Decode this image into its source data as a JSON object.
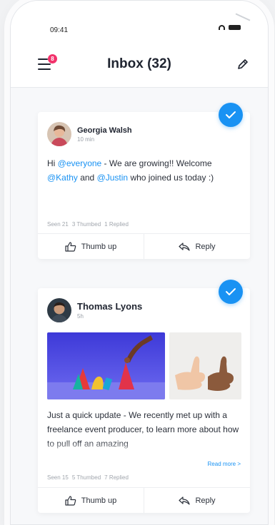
{
  "status": {
    "time": "09:41"
  },
  "nav": {
    "title": "Inbox (32)",
    "menu_badge": "8"
  },
  "posts": [
    {
      "author": "Georgia Walsh",
      "time": "10 min",
      "text_parts": [
        "Hi ",
        "@everyone",
        " - We are growing!! Welcome ",
        "@Kathy",
        " and ",
        "@Justin",
        " who joined us today :)"
      ],
      "stats": {
        "seen": "Seen 21",
        "thumbed": "3 Thumbed",
        "replied": "1 Replied"
      },
      "actions": {
        "thumb": "Thumb up",
        "reply": "Reply"
      }
    },
    {
      "author": "Thomas Lyons",
      "time": "5h",
      "text": "Just a quick update - We recently met up with a freelance event producer, to learn more about how to pull off an amazing",
      "read_more": "Read more >",
      "stats": {
        "seen": "Seen 15",
        "thumbed": "5 Thumbed",
        "replied": "7 Replied"
      },
      "actions": {
        "thumb": "Thumb up",
        "reply": "Reply"
      }
    }
  ],
  "colors": {
    "accent": "#1992f3",
    "badge": "#f2326b"
  },
  "icons": [
    "menu-icon",
    "edit-pencil-icon",
    "check-icon",
    "thumb-up-icon",
    "reply-icon",
    "wifi-icon",
    "battery-icon"
  ]
}
